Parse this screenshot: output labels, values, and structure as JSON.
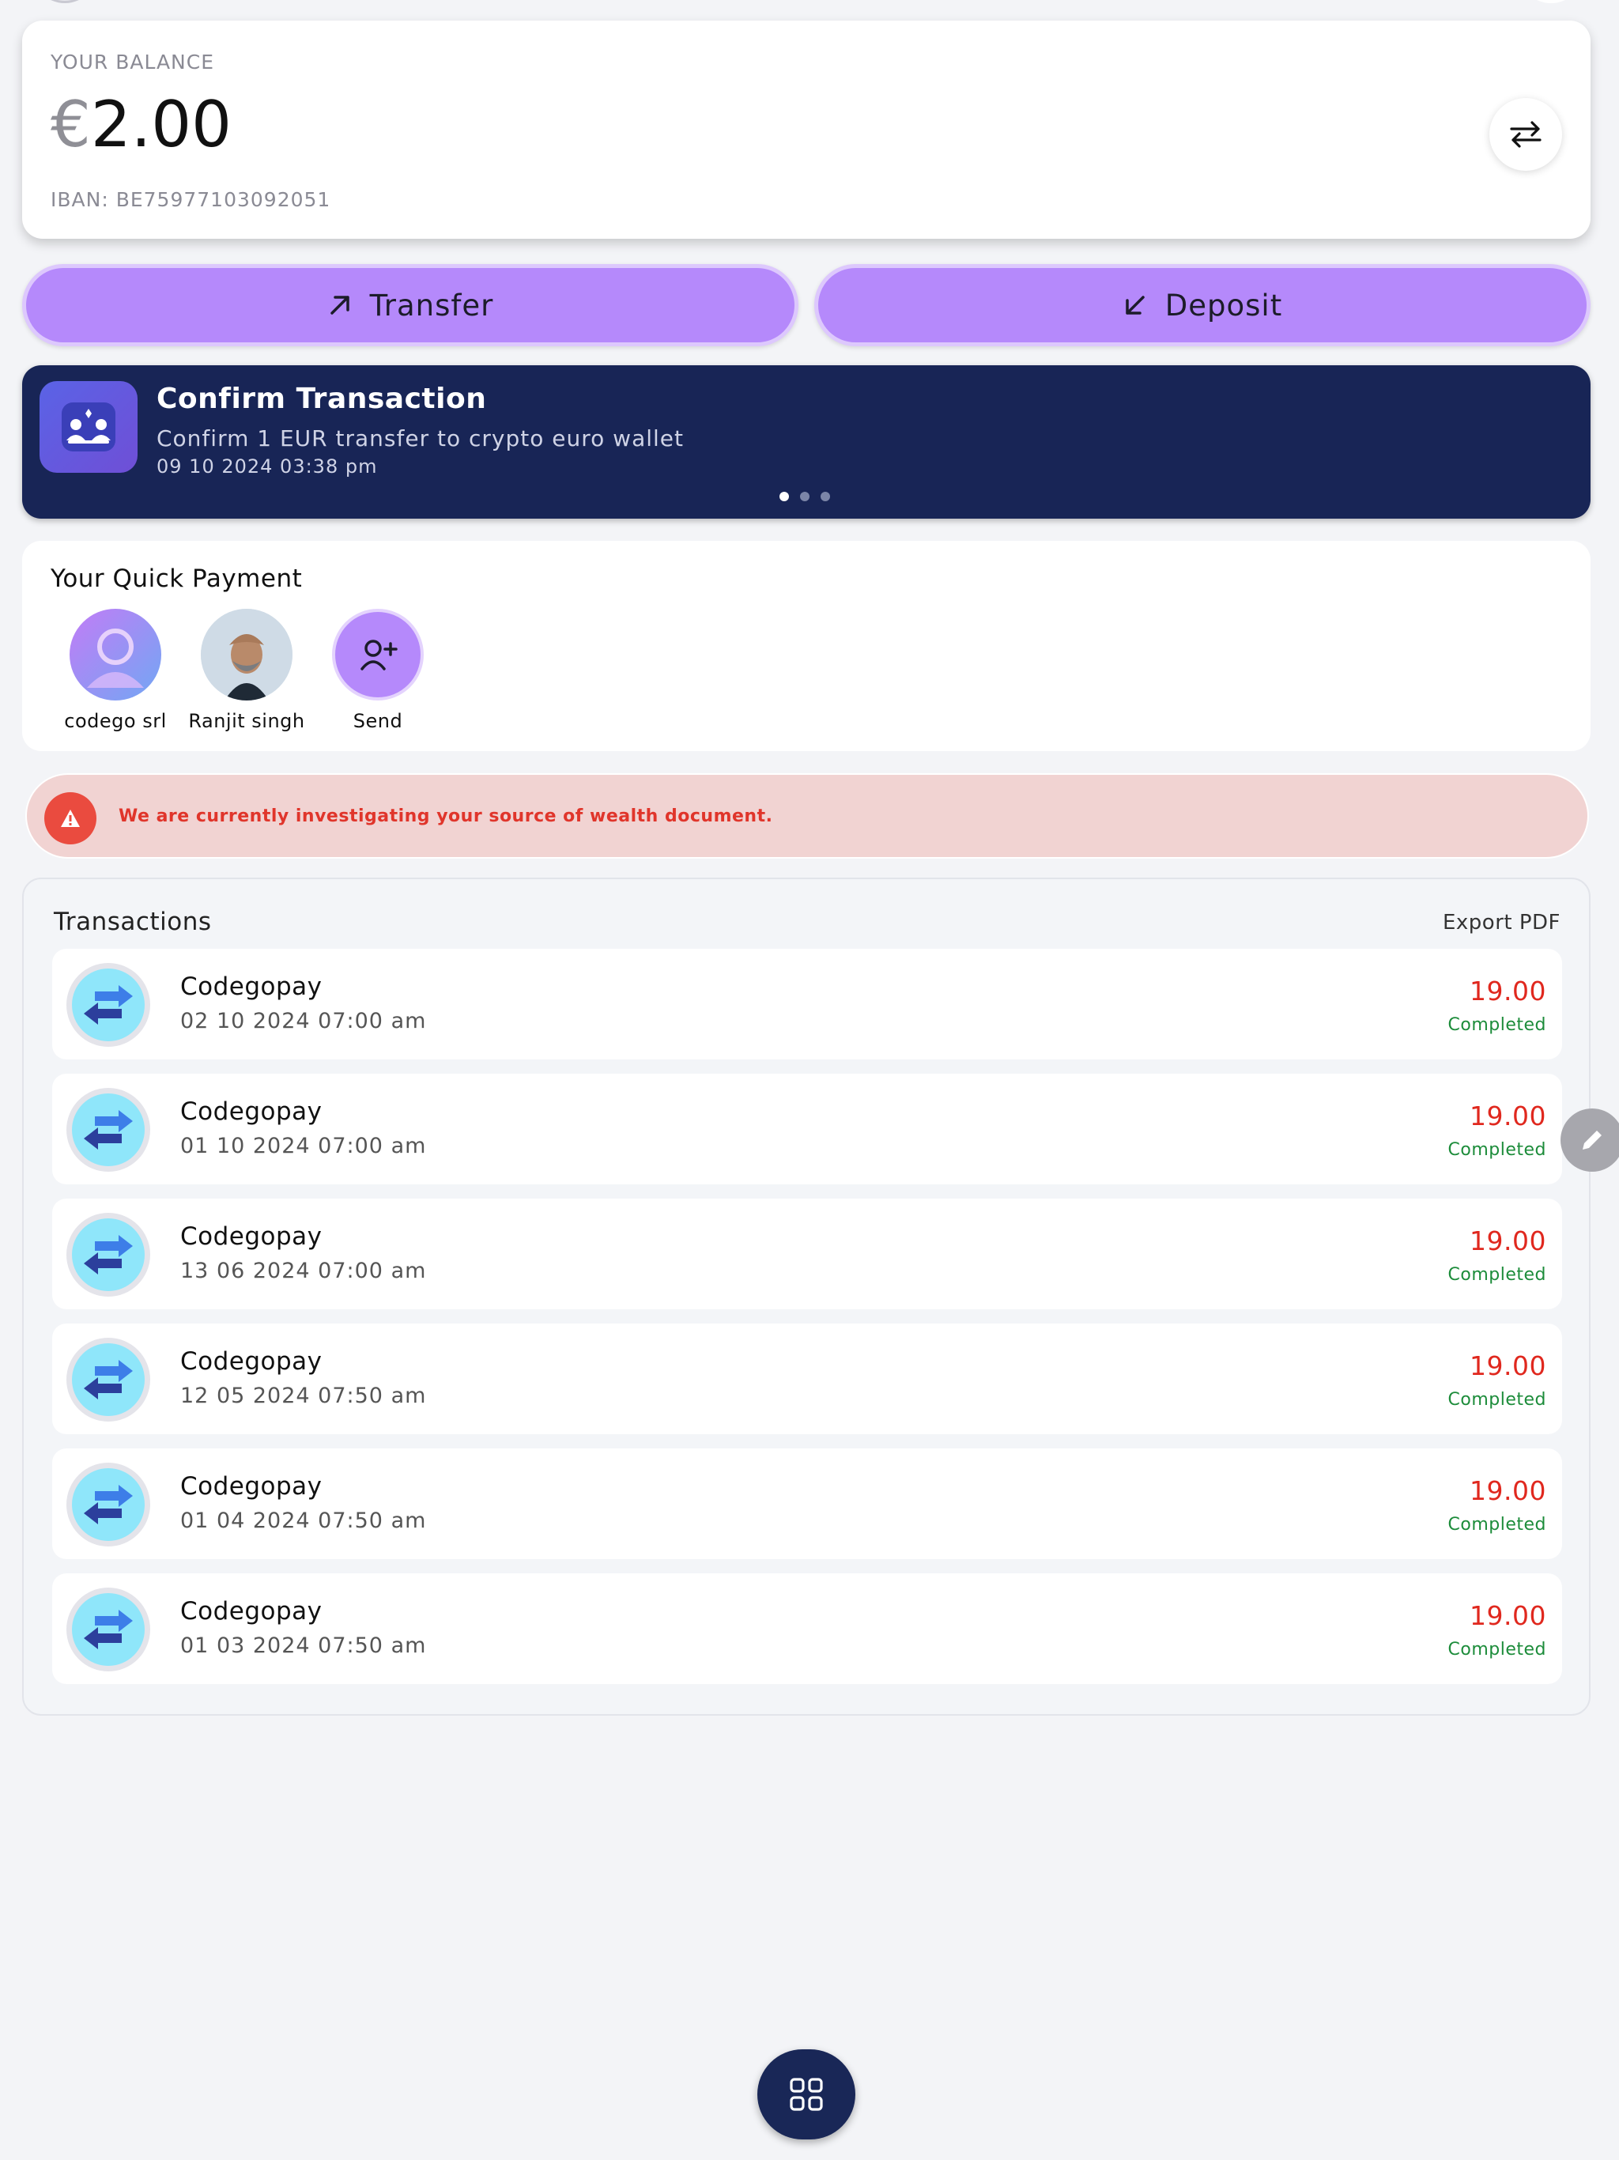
{
  "balance": {
    "label": "YOUR BALANCE",
    "currency_symbol": "€",
    "amount": "2.00",
    "iban": "IBAN: BE75977103092051",
    "swap_icon": "swap-arrows-icon"
  },
  "actions": {
    "transfer_label": "Transfer",
    "transfer_icon": "arrow-up-right-icon",
    "deposit_label": "Deposit",
    "deposit_icon": "arrow-down-left-icon",
    "accent": "#b589fb"
  },
  "notification": {
    "title": "Confirm Transaction",
    "description": "Confirm 1 EUR transfer to crypto euro wallet",
    "datetime": "09 10 2024 03:38 pm",
    "page_count": 3,
    "active_page": 1,
    "background": "#182556"
  },
  "quick_payment": {
    "title": "Your Quick Payment",
    "contacts": [
      {
        "name": "codego srl",
        "avatar": "default-user-avatar"
      },
      {
        "name": "Ranjit singh",
        "avatar": "photo-avatar"
      },
      {
        "name": "Send",
        "avatar": "add-user-icon"
      }
    ]
  },
  "alert": {
    "text": "We are currently investigating your source of wealth document.",
    "icon": "warning-icon",
    "color": "#e0352b"
  },
  "transactions": {
    "title": "Transactions",
    "export_label": "Export PDF",
    "items": [
      {
        "name": "Codegopay",
        "date": "02 10 2024 07:00 am",
        "amount": "19.00",
        "status": "Completed"
      },
      {
        "name": "Codegopay",
        "date": "01 10 2024 07:00 am",
        "amount": "19.00",
        "status": "Completed"
      },
      {
        "name": "Codegopay",
        "date": "13 06 2024 07:00 am",
        "amount": "19.00",
        "status": "Completed"
      },
      {
        "name": "Codegopay",
        "date": "12 05 2024 07:50 am",
        "amount": "19.00",
        "status": "Completed"
      },
      {
        "name": "Codegopay",
        "date": "01 04 2024 07:50 am",
        "amount": "19.00",
        "status": "Completed"
      },
      {
        "name": "Codegopay",
        "date": "01 03 2024 07:50 am",
        "amount": "19.00",
        "status": "Completed"
      }
    ],
    "amount_color": "#e0281e",
    "status_color": "#1c8c3a"
  },
  "floating": {
    "edit_icon": "pencil-icon",
    "menu_icon": "grid-icon"
  }
}
